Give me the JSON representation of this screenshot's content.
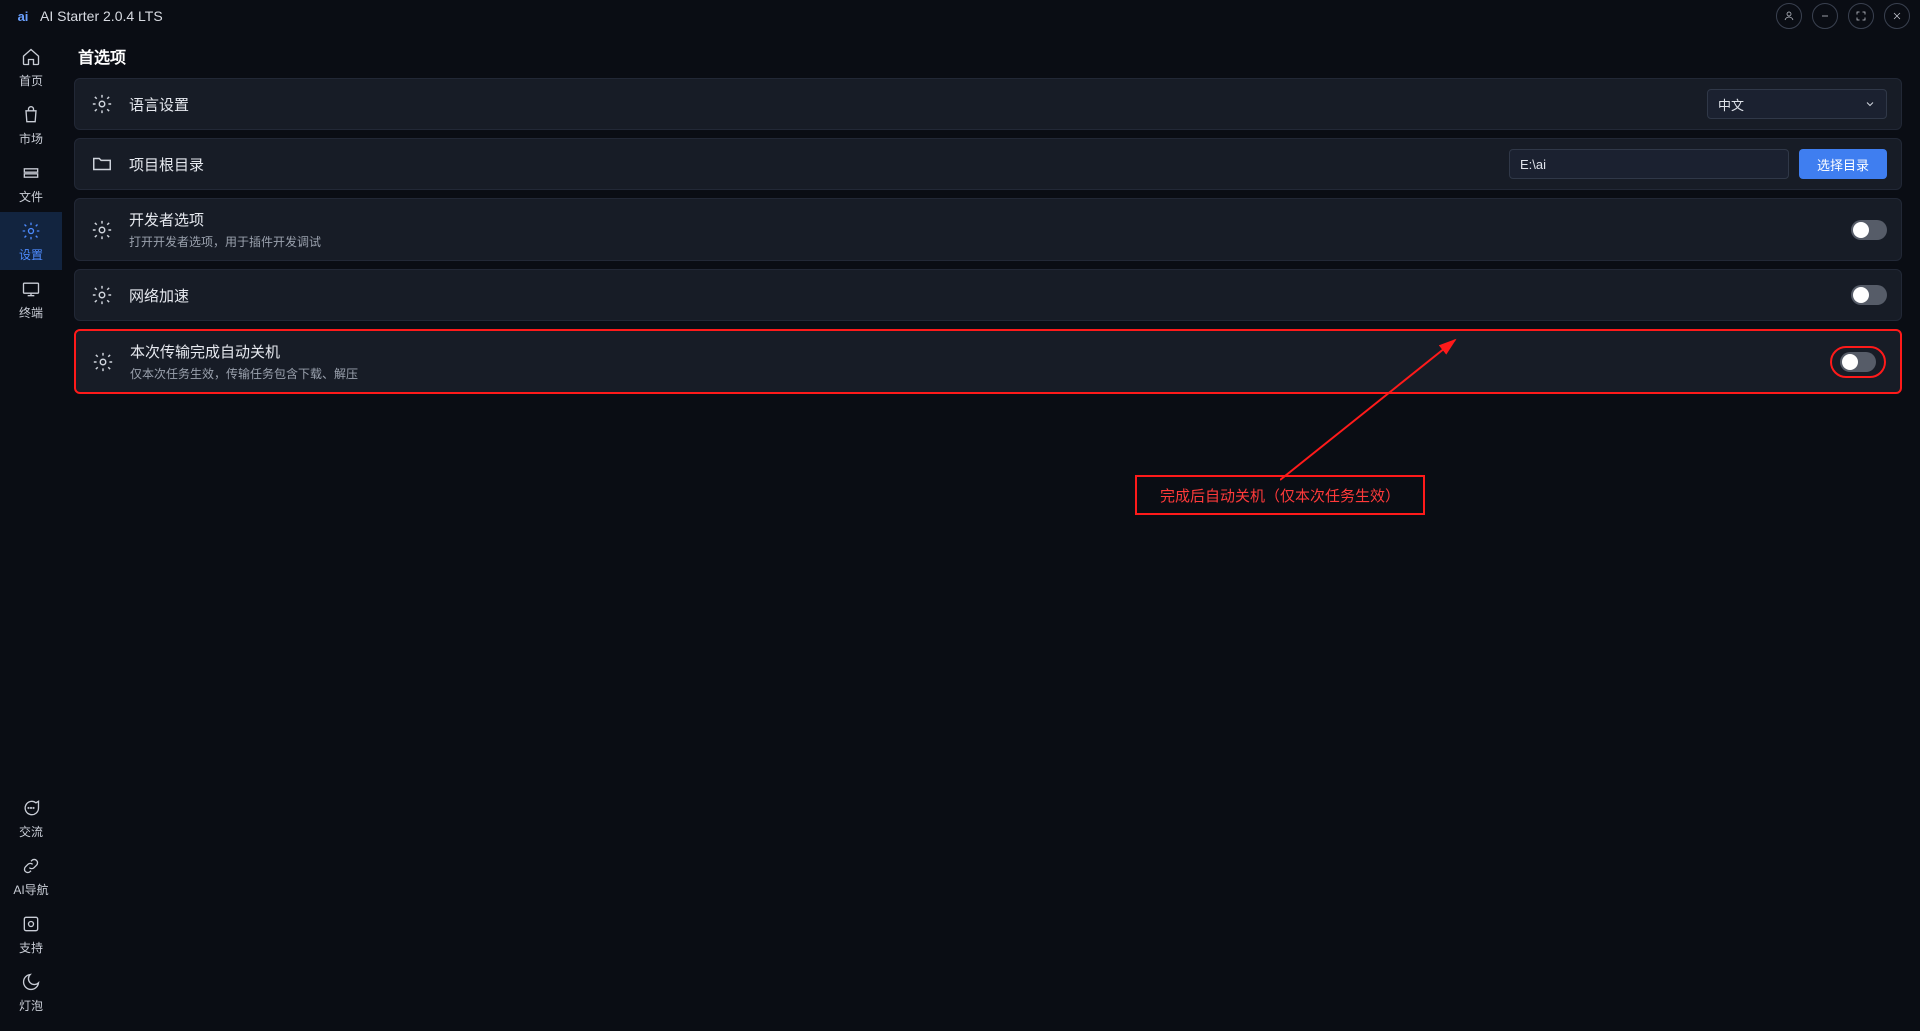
{
  "app": {
    "title": "AI Starter 2.0.4 LTS"
  },
  "sidebar": {
    "top": [
      {
        "label": "首页"
      },
      {
        "label": "市场"
      },
      {
        "label": "文件"
      },
      {
        "label": "设置"
      },
      {
        "label": "终端"
      }
    ],
    "bottom": [
      {
        "label": "交流"
      },
      {
        "label": "AI导航"
      },
      {
        "label": "支持"
      },
      {
        "label": "灯泡"
      }
    ]
  },
  "page": {
    "title": "首选项"
  },
  "settings": {
    "language": {
      "label": "语言设置",
      "value": "中文"
    },
    "project_root": {
      "label": "项目根目录",
      "path": "E:\\ai",
      "button": "选择目录"
    },
    "developer": {
      "label": "开发者选项",
      "desc": "打开开发者选项，用于插件开发调试"
    },
    "network": {
      "label": "网络加速"
    },
    "shutdown": {
      "label": "本次传输完成自动关机",
      "desc": "仅本次任务生效，传输任务包含下载、解压"
    }
  },
  "annotation": {
    "text": "完成后自动关机（仅本次任务生效）"
  }
}
